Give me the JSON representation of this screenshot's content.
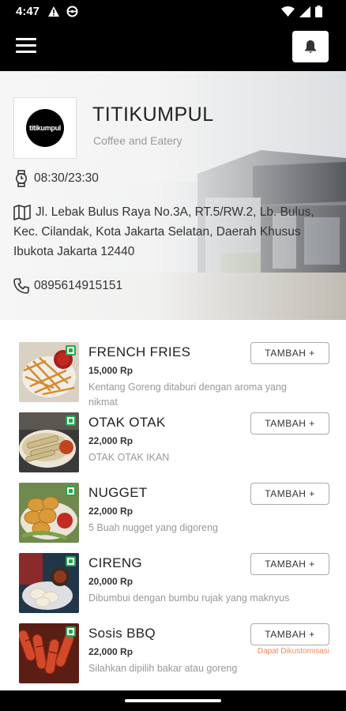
{
  "status_bar": {
    "time": "4:47",
    "icons_left": [
      "warning-icon",
      "steering-icon"
    ],
    "icons_right": [
      "wifi-icon",
      "signal-icon",
      "battery-icon"
    ]
  },
  "app_bar": {
    "menu_icon": "hamburger-menu-icon",
    "bell_icon": "bell-icon"
  },
  "shop": {
    "logo_text": "titikumpul",
    "name": "TITIKUMPUL",
    "subtitle": "Coffee and Eatery",
    "hours": "08:30/23:30",
    "address": "Jl. Lebak Bulus Raya No.3A, RT.5/RW.2, Lb. Bulus, Kec. Cilandak, Kota Jakarta Selatan, Daerah Khusus Ibukota Jakarta 12440",
    "phone": "0895614915151"
  },
  "menu": {
    "add_label": "TAMBAH +",
    "items": [
      {
        "name": "FRENCH FRIES",
        "price": "15,000 Rp",
        "description": "Kentang Goreng ditaburi dengan aroma yang nikmat",
        "custom": ""
      },
      {
        "name": "OTAK OTAK",
        "price": "22,000 Rp",
        "description": "OTAK OTAK IKAN",
        "custom": ""
      },
      {
        "name": "NUGGET",
        "price": "22,000 Rp",
        "description": "5 Buah nugget yang digoreng",
        "custom": ""
      },
      {
        "name": "CIRENG",
        "price": "20,000 Rp",
        "description": "Dibumbui dengan bumbu rujak yang maknyus",
        "custom": ""
      },
      {
        "name": "Sosis BBQ",
        "price": "22,000 Rp",
        "description": "Silahkan dipilih bakar atau goreng",
        "custom": "Dapat Dikustomisasi"
      }
    ]
  },
  "colors": {
    "veg_badge": "#22a84a",
    "custom_text": "#f08a5d"
  }
}
